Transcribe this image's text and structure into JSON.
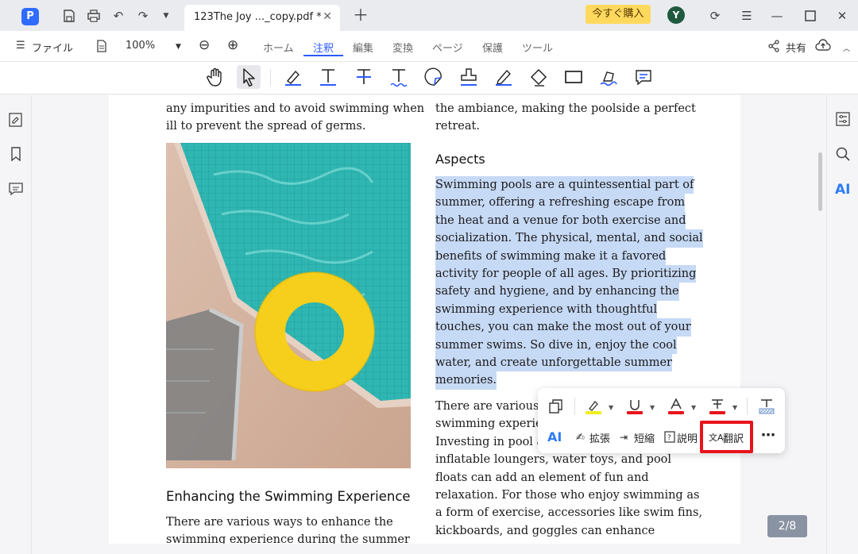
{
  "titlebar": {
    "tab_title": "123The Joy ..._copy.pdf *",
    "buy_label": "今すぐ購入",
    "avatar_initial": "Y"
  },
  "menubar": {
    "file_label": "ファイル",
    "zoom": "100%",
    "tabs": [
      "ホーム",
      "注釈",
      "編集",
      "変換",
      "ページ",
      "保護",
      "ツール"
    ],
    "active_tab": "注釈",
    "share_label": "共有"
  },
  "tools": [
    "hand-tool",
    "select-tool",
    "highlight-tool",
    "underline-tool",
    "strikethrough-tool",
    "squiggly-tool",
    "sticky-note-tool",
    "stamp-tool",
    "pencil-tool",
    "eraser-tool",
    "rectangle-tool",
    "signature-tool",
    "comment-tool"
  ],
  "document": {
    "col1_top": [
      "any impurities and to avoid swimming when",
      "ill to prevent the spread of germs."
    ],
    "col2_top": [
      "the ambiance, making the poolside a perfect",
      "retreat."
    ],
    "aspects_heading": "Aspects",
    "aspects_lines": [
      "Swimming pools are a quintessential part of",
      "summer, offering a refreshing escape from",
      "the heat and a venue for both exercise and",
      "socialization. The physical, mental, and social",
      "benefits of swimming make it a favored",
      "activity for people of all ages. By prioritizing",
      "safety and hygiene, and by enhancing the",
      "swimming experience with thoughtful",
      "touches, you can make the most out of your",
      "summer swims. So dive in, enjoy the cool",
      "water, and create unforgettable summer",
      "memories."
    ],
    "col2_bottom": [
      "There are various w",
      "swimming experien",
      "Investing in pool ac",
      "inflatable loungers, water toys, and pool",
      "floats can add an element of fun and",
      "relaxation. For those who enjoy swimming as",
      "a form of exercise, accessories like swim fins,",
      "kickboards, and goggles can enhance"
    ],
    "enhancing_heading": "Enhancing the Swimming Experience",
    "col1_bottom": [
      "There are various ways to enhance the",
      "swimming experience during the summer"
    ]
  },
  "float_toolbar": {
    "expand_label": "拡張",
    "shorten_label": "短縮",
    "explain_label": "説明",
    "translate_label": "翻訳",
    "ai_label": "AI",
    "more_label": "⋯"
  },
  "page_indicator": "2/8",
  "colors": {
    "accent": "#2d5bff",
    "highlight": "#c6d9f5",
    "translate_outline": "#e8141b",
    "buy_button": "#ffd95e"
  }
}
